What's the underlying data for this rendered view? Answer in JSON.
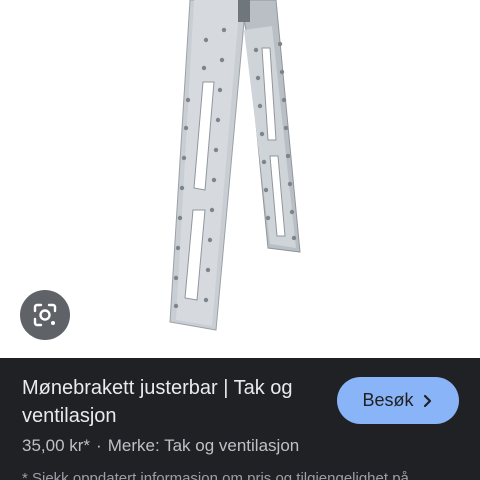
{
  "product": {
    "title": "Mønebrakett justerbar | Tak og ventilasjon",
    "price": "35,00 kr*",
    "separator": "·",
    "brand": "Merke: Tak og ventilasjon",
    "disclaimer": "* Sjekk oppdatert informasjon om pris og tilgjengelighet på"
  },
  "actions": {
    "visit_label": "Besøk",
    "visit_icon": "chevron-right-icon",
    "lens_icon": "google-lens-icon"
  },
  "colors": {
    "panel_bg": "#202124",
    "button_bg": "#8ab4f8",
    "lens_bg": "#5f6368"
  }
}
